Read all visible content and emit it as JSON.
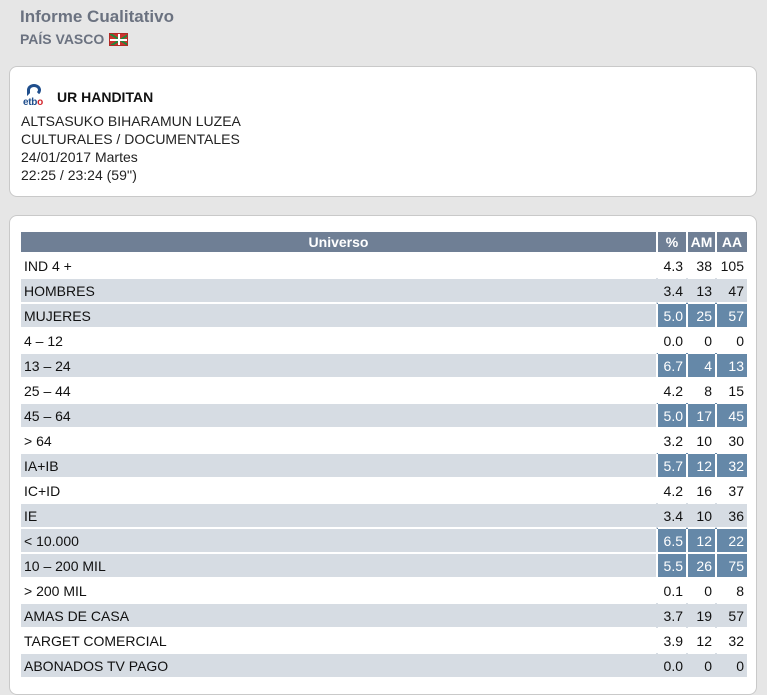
{
  "header": {
    "title": "Informe Cualitativo",
    "region": "PAÍS VASCO"
  },
  "program": {
    "channel_logo": "etb",
    "name": "UR HANDITAN",
    "episode": "ALTSASUKO BIHARAMUN LUZEA",
    "genre": "CULTURALES / DOCUMENTALES",
    "date": "24/01/2017 Martes",
    "time": "22:25 / 23:24 (59'')"
  },
  "table": {
    "columns": [
      "Universo",
      "%",
      "AM",
      "AA"
    ],
    "rows": [
      {
        "label": "IND 4 +",
        "pct": "4.3",
        "am": "38",
        "aa": "105",
        "style": "plain"
      },
      {
        "label": "HOMBRES",
        "pct": "3.4",
        "am": "13",
        "aa": "47",
        "style": "shade"
      },
      {
        "label": "MUJERES",
        "pct": "5.0",
        "am": "25",
        "aa": "57",
        "style": "hl"
      },
      {
        "label": "4 – 12",
        "pct": "0.0",
        "am": "0",
        "aa": "0",
        "style": "plain"
      },
      {
        "label": "13 – 24",
        "pct": "6.7",
        "am": "4",
        "aa": "13",
        "style": "hl"
      },
      {
        "label": "25 – 44",
        "pct": "4.2",
        "am": "8",
        "aa": "15",
        "style": "plain"
      },
      {
        "label": "45 – 64",
        "pct": "5.0",
        "am": "17",
        "aa": "45",
        "style": "hl"
      },
      {
        "label": "> 64",
        "pct": "3.2",
        "am": "10",
        "aa": "30",
        "style": "plain"
      },
      {
        "label": "IA+IB",
        "pct": "5.7",
        "am": "12",
        "aa": "32",
        "style": "hl"
      },
      {
        "label": "IC+ID",
        "pct": "4.2",
        "am": "16",
        "aa": "37",
        "style": "plain"
      },
      {
        "label": "IE",
        "pct": "3.4",
        "am": "10",
        "aa": "36",
        "style": "shade"
      },
      {
        "label": "< 10.000",
        "pct": "6.5",
        "am": "12",
        "aa": "22",
        "style": "hl"
      },
      {
        "label": "10 – 200 MIL",
        "pct": "5.5",
        "am": "26",
        "aa": "75",
        "style": "hl"
      },
      {
        "label": "> 200 MIL",
        "pct": "0.1",
        "am": "0",
        "aa": "8",
        "style": "plain"
      },
      {
        "label": "AMAS DE CASA",
        "pct": "3.7",
        "am": "19",
        "aa": "57",
        "style": "shade"
      },
      {
        "label": "TARGET COMERCIAL",
        "pct": "3.9",
        "am": "12",
        "aa": "32",
        "style": "plain"
      },
      {
        "label": "ABONADOS TV PAGO",
        "pct": "0.0",
        "am": "0",
        "aa": "0",
        "style": "shade"
      }
    ]
  },
  "colors": {
    "header_bg": "#6f7f95",
    "shade_row": "#d6dce3",
    "highlight_cell": "#6588a8"
  }
}
